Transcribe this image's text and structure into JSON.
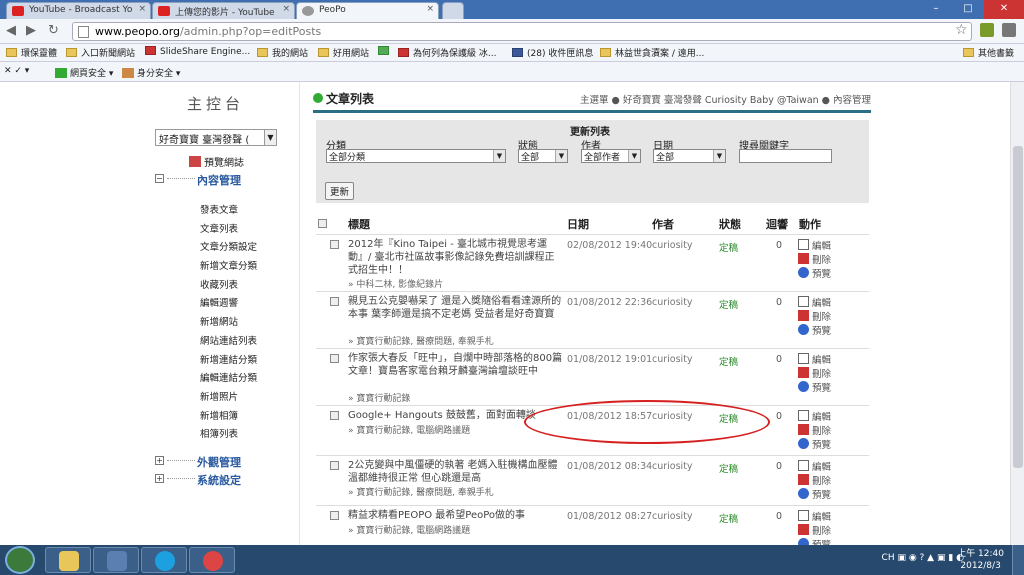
{
  "browser": {
    "tabs": [
      {
        "title": "YouTube - Broadcast Yo"
      },
      {
        "title": "上傳您的影片 - YouTube"
      },
      {
        "title": "PeoPo"
      }
    ],
    "url_domain": "www.peopo.org",
    "url_path": "/admin.php?op=editPosts",
    "bookmarks": [
      "環保靈體",
      "入口新聞網站",
      "SlideShare Engine...",
      "我的網站",
      "好用網站",
      "為何列為保護級 冰...",
      "(28) 收件匣訊息",
      "林益世貪瀆案 / 遠用...",
      "其他書籤"
    ],
    "toolbar": [
      "網頁安全",
      "身分安全"
    ]
  },
  "sidebar": {
    "title": "主控台",
    "select_value": "好奇寶寶 臺灣發聲 (",
    "preview": "預覽網誌",
    "sections": [
      {
        "label": "內容管理",
        "expanded": true
      },
      {
        "label": "外觀管理",
        "expanded": false
      },
      {
        "label": "系統設定",
        "expanded": false
      }
    ],
    "items": [
      "發表文章",
      "文章列表",
      "文章分類設定",
      "新增文章分類",
      "收藏列表",
      "編輯週響",
      "新增網站",
      "網站連結列表",
      "新增連結分類",
      "編輯連結分類",
      "新增照片",
      "新增相簿",
      "相簿列表"
    ]
  },
  "content": {
    "title": "文章列表",
    "breadcrumb": "主選單 ● 好奇寶寶 臺灣發聲 Curiosity Baby @Taiwan ● 內容管理",
    "filter": {
      "title": "更新列表",
      "labels": {
        "category": "分類",
        "status": "狀態",
        "author": "作者",
        "date": "日期",
        "keyword": "搜尋關鍵字"
      },
      "values": {
        "category": "全部分類",
        "status": "全部",
        "author": "全部作者",
        "date": "全部"
      },
      "button": "更新"
    },
    "columns": [
      "標題",
      "日期",
      "作者",
      "狀態",
      "迴響",
      "動作"
    ],
    "actions": [
      "編輯",
      "刪除",
      "預覽"
    ],
    "rows": [
      {
        "title": "2012年『Kino Taipei - 臺北城市視覺思考運動』/ 臺北市社區故事影像記錄免費培訓課程正式招生中！！",
        "tags": "» 中科二林, 影像紀錄片",
        "date": "02/08/2012 19:40",
        "author": "curiosity",
        "status": "定稿",
        "comments": "0"
      },
      {
        "title": "親見五公克嬰嚇呆了 還是入獎隨俗看看達源所的本事 葉李師還是搞不定老媽 受益者是好奇寶寶",
        "tags": "» 寶寶行動記錄, 醫療問題, 奉親手札",
        "date": "01/08/2012 22:36",
        "author": "curiosity",
        "status": "定稿",
        "comments": "0"
      },
      {
        "title": "作家張大春反「旺中」，自爛中時部落格的800篇文章！寶島客家電台賴牙麟臺灣論壇談旺中",
        "tags": "» 寶寶行動記錄",
        "date": "01/08/2012 19:01",
        "author": "curiosity",
        "status": "定稿",
        "comments": "0"
      },
      {
        "title": "Google+ Hangouts 鼓鼓舊，面對面轉談",
        "tags": "» 寶寶行動記錄, 電腦網路議題",
        "date": "01/08/2012 18:57",
        "author": "curiosity",
        "status": "定稿",
        "comments": "0"
      },
      {
        "title": "2公克變與中風僵硬的執著 老媽入駐機構血壓體溫都維持很正常 但心跳還是高",
        "tags": "» 寶寶行動記錄, 醫療問題, 奉親手札",
        "date": "01/08/2012 08:34",
        "author": "curiosity",
        "status": "定稿",
        "comments": "0"
      },
      {
        "title": "精益求精看PEOPO 最希望PeoPo做的事",
        "tags": "» 寶寶行動記錄, 電腦網路議題",
        "date": "01/08/2012 08:27",
        "author": "curiosity",
        "status": "定稿",
        "comments": "0"
      }
    ]
  },
  "taskbar": {
    "tray": "CH",
    "time": "上午 12:40",
    "date": "2012/8/3"
  }
}
